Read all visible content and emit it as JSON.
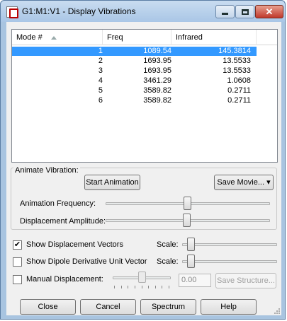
{
  "window": {
    "title": "G1:M1:V1 - Display Vibrations",
    "close_glyph": "✕"
  },
  "list": {
    "headers": {
      "mode": "Mode #",
      "freq": "Freq",
      "ir": "Infrared"
    },
    "rows": [
      {
        "mode": "1",
        "freq": "1089.54",
        "ir": "145.3814",
        "selected": true
      },
      {
        "mode": "2",
        "freq": "1693.95",
        "ir": "13.5533"
      },
      {
        "mode": "3",
        "freq": "1693.95",
        "ir": "13.5533"
      },
      {
        "mode": "4",
        "freq": "3461.29",
        "ir": "1.0608"
      },
      {
        "mode": "5",
        "freq": "3589.82",
        "ir": "0.2711"
      },
      {
        "mode": "6",
        "freq": "3589.82",
        "ir": "0.2711"
      }
    ]
  },
  "animate": {
    "group_label": "Animate Vibration:",
    "start_label": "Start Animation",
    "save_movie_label": "Save Movie...",
    "frequency_label": "Animation Frequency:",
    "amplitude_label": "Displacement Amplitude:"
  },
  "options": {
    "show_vectors_label": "Show Displacement Vectors",
    "show_vectors_checked": true,
    "check_glyph": "✔",
    "show_dipole_label": "Show Dipole Derivative Unit Vector",
    "show_dipole_checked": false,
    "scale_label": "Scale:",
    "manual_label": "Manual Displacement:",
    "manual_checked": false,
    "manual_value": "0.00",
    "save_structure_label": "Save Structure..."
  },
  "footer": {
    "close_label": "Close",
    "cancel_label": "Cancel",
    "spectrum_label": "Spectrum",
    "help_label": "Help"
  },
  "colors": {
    "selection": "#3399ff",
    "frame": "#a8c4e0",
    "close_button": "#c0392b"
  }
}
